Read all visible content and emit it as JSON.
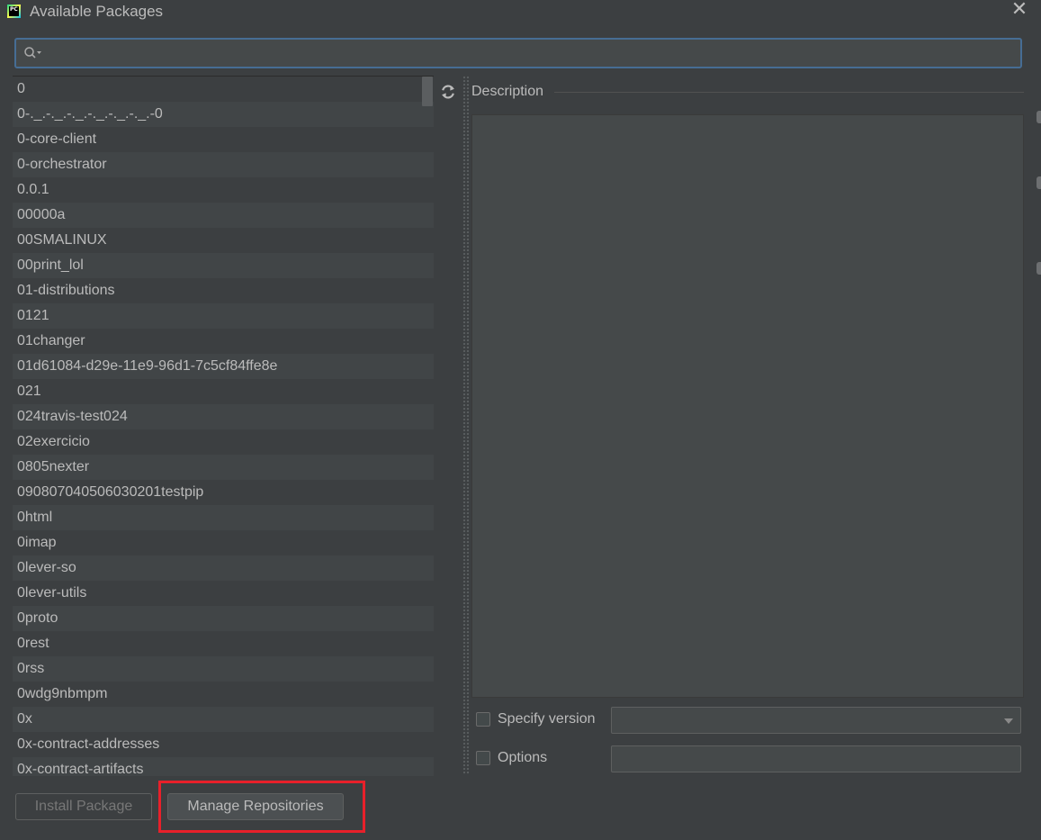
{
  "window": {
    "title": "Available Packages",
    "app_icon_text": "PC",
    "close_symbol": "✕"
  },
  "search": {
    "value": "",
    "placeholder": ""
  },
  "packages": [
    "0",
    "0-._.-._.-._.-._.-._.-._.-0",
    "0-core-client",
    "0-orchestrator",
    "0.0.1",
    "00000a",
    "00SMALINUX",
    "00print_lol",
    "01-distributions",
    "0121",
    "01changer",
    "01d61084-d29e-11e9-96d1-7c5cf84ffe8e",
    "021",
    "024travis-test024",
    "02exercicio",
    "0805nexter",
    "090807040506030201testpip",
    "0html",
    "0imap",
    "0lever-so",
    "0lever-utils",
    "0proto",
    "0rest",
    "0rss",
    "0wdg9nbmpm",
    "0x",
    "0x-contract-addresses",
    "0x-contract-artifacts"
  ],
  "description": {
    "label": "Description",
    "content": ""
  },
  "options": {
    "specify_version_label": "Specify version",
    "specify_version_checked": false,
    "version_value": "",
    "options_label": "Options",
    "options_checked": false,
    "options_value": ""
  },
  "buttons": {
    "install": "Install Package",
    "manage": "Manage Repositories"
  },
  "colors": {
    "background": "#3c3f41",
    "field": "#45494a",
    "focus_border": "#466d94",
    "highlight": "#e8202a",
    "text": "#bbbbbb"
  },
  "icons": {
    "search": "search-icon",
    "refresh": "refresh-icon",
    "close": "close-icon",
    "dropdown": "chevron-down-icon"
  }
}
